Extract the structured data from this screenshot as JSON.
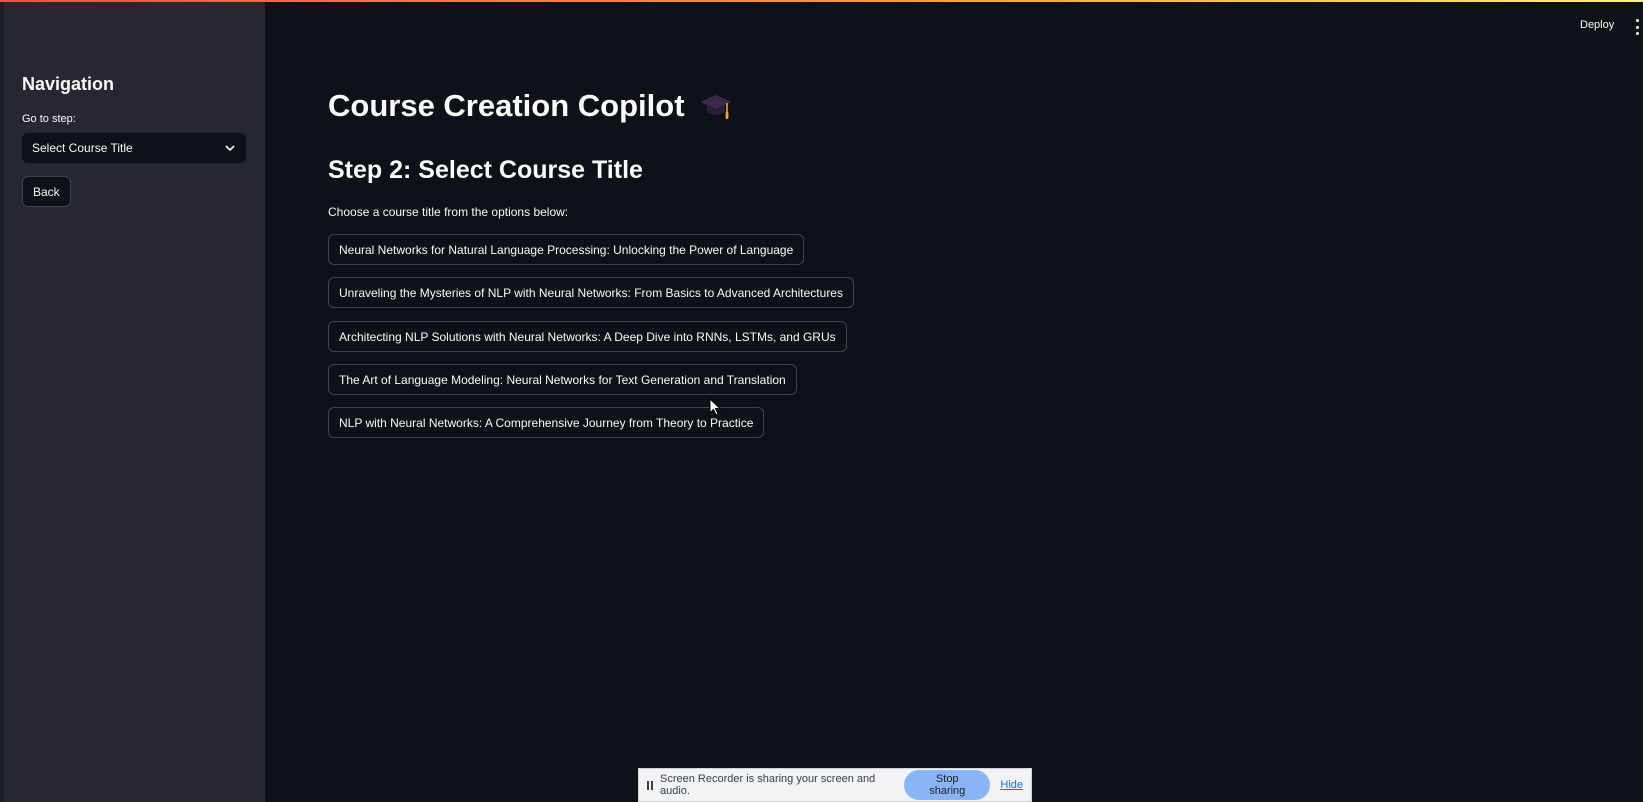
{
  "header": {
    "deploy_label": "Deploy"
  },
  "sidebar": {
    "heading": "Navigation",
    "step_label": "Go to step:",
    "step_select_value": "Select Course Title",
    "back_label": "Back"
  },
  "main": {
    "title": "Course Creation Copilot",
    "title_icon": "graduation-cap-icon",
    "step_heading": "Step 2: Select Course Title",
    "intro": "Choose a course title from the options below:",
    "options": [
      "Neural Networks for Natural Language Processing: Unlocking the Power of Language",
      "Unraveling the Mysteries of NLP with Neural Networks: From Basics to Advanced Architectures",
      "Architecting NLP Solutions with Neural Networks: A Deep Dive into RNNs, LSTMs, and GRUs",
      "The Art of Language Modeling: Neural Networks for Text Generation and Translation",
      "NLP with Neural Networks: A Comprehensive Journey from Theory to Practice"
    ]
  },
  "share_bar": {
    "message": "Screen Recorder is sharing your screen and audio.",
    "stop_label": "Stop sharing",
    "hide_label": "Hide"
  },
  "colors": {
    "background": "#0e1117",
    "sidebar": "#262730",
    "text": "#fafafa",
    "stop_button": "#8ab4f8"
  }
}
